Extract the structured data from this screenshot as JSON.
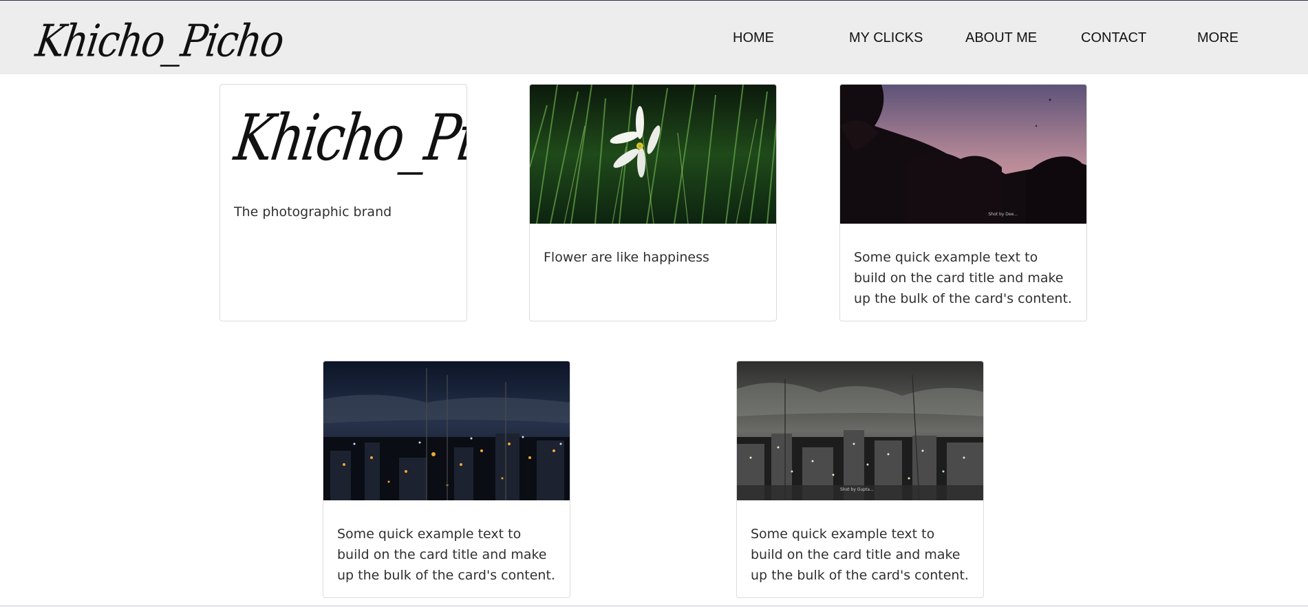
{
  "brand": {
    "name": "Khicho_Picho"
  },
  "nav": {
    "items": [
      {
        "label": "HOME"
      },
      {
        "label": "MY CLICKS"
      },
      {
        "label": "ABOUT ME"
      },
      {
        "label": "CONTACT"
      },
      {
        "label": "MORE"
      }
    ]
  },
  "cards": [
    {
      "logo_text": "Khicho_Picho",
      "text": "The photographic brand",
      "image": "signature-logo"
    },
    {
      "text": "Flower are like happiness",
      "image": "white-flower-in-grass"
    },
    {
      "text": "Some quick example text to build on the card title and make up the bulk of the card's content.",
      "image": "tree-silhouette-dusk",
      "watermark": "Shot by Dee..."
    },
    {
      "text": "Some quick example text to build on the card title and make up the bulk of the card's content.",
      "image": "city-night-skyline"
    },
    {
      "text": "Some quick example text to build on the card title and make up the bulk of the card's content.",
      "image": "city-cloudy-night",
      "watermark": "Shot by Gupta..."
    }
  ],
  "colors": {
    "navbar_bg": "#ededed",
    "page_bg": "#ffffff",
    "text": "#2f2f2f",
    "card_border": "#dcdcdc"
  }
}
